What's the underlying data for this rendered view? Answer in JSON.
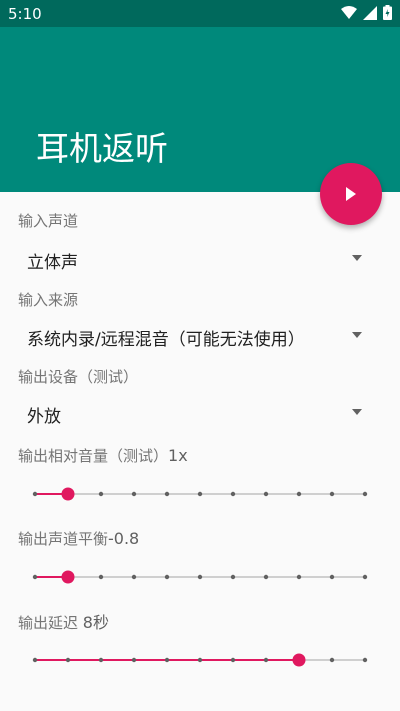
{
  "status_bar": {
    "time": "5:10"
  },
  "app_bar": {
    "title": "耳机返听"
  },
  "fab": {
    "icon": "play-icon"
  },
  "settings": {
    "input_channel": {
      "label": "输入声道",
      "selected": "立体声"
    },
    "input_source": {
      "label": "输入来源",
      "selected": "系统内录/远程混音（可能无法使用）"
    },
    "output_device": {
      "label": "输出设备（测试）",
      "selected": "外放"
    },
    "output_volume": {
      "label": "输出相对音量（测试）",
      "value_text": "1x",
      "steps": 11,
      "position": 1
    },
    "output_balance": {
      "label": "输出声道平衡",
      "value_text": "-0.8",
      "steps": 11,
      "position": 1
    },
    "output_delay": {
      "label": "输出延迟",
      "value_text": "8秒",
      "steps": 11,
      "position": 8
    }
  },
  "colors": {
    "primary": "#00897b",
    "primary_dark": "#00695c",
    "accent": "#e0185f"
  }
}
